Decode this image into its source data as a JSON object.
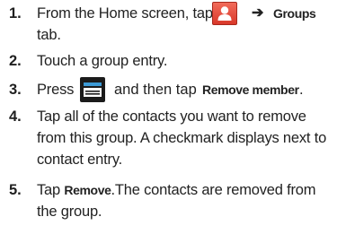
{
  "steps": [
    {
      "number": "1.",
      "text_a": "From the Home screen, tap",
      "arrow": "➔",
      "bold_a": "Groups",
      "text_b": "tab.",
      "icon": "contacts-icon"
    },
    {
      "number": "2.",
      "text_a": "Touch a group entry."
    },
    {
      "number": "3.",
      "text_a": "Press",
      "text_b": "and then tap",
      "bold_a": "Remove member",
      "text_c": ".",
      "icon": "menu-icon"
    },
    {
      "number": "4.",
      "line1": "Tap all of the contacts you want to remove",
      "line2": "from this group. A checkmark displays next to",
      "line3": "contact entry."
    },
    {
      "number": "5.",
      "text_a": "Tap",
      "bold_a": "Remove",
      "text_b": ".The contacts are removed from",
      "line2": "the group."
    }
  ],
  "colors": {
    "contacts_icon": "#e5473a",
    "menu_icon": "#1b1b1b",
    "text": "#222222"
  }
}
